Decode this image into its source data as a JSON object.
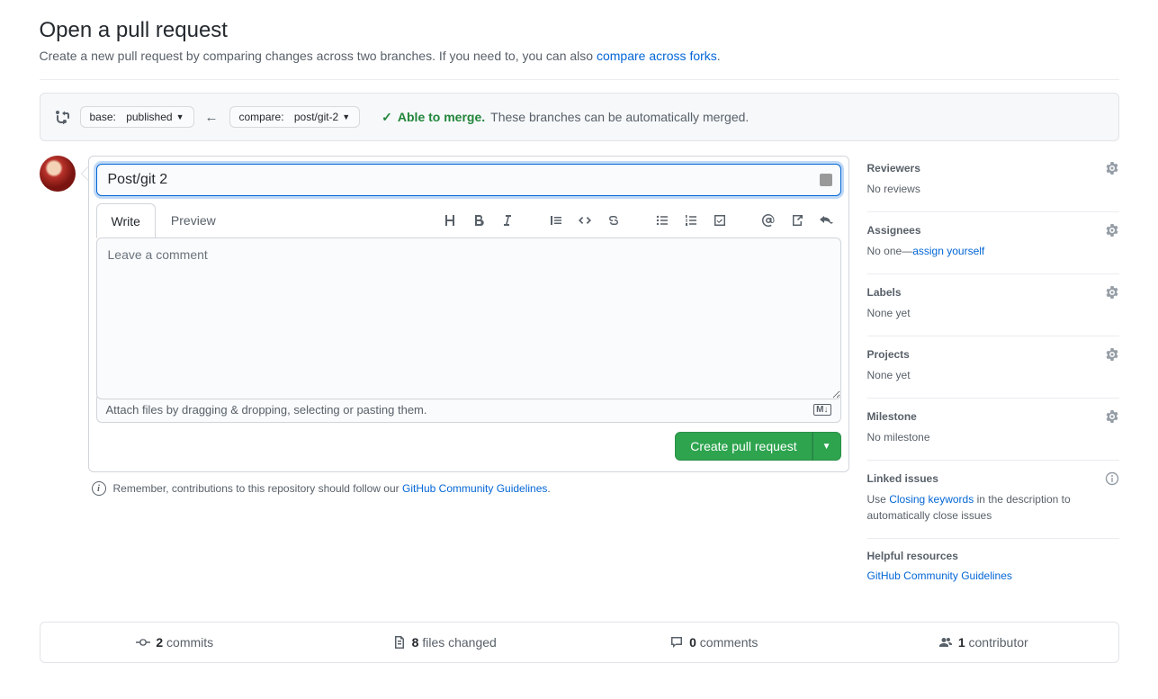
{
  "header": {
    "title": "Open a pull request",
    "desc_pre": "Create a new pull request by comparing changes across two branches. If you need to, you can also ",
    "desc_link": "compare across forks",
    "desc_post": "."
  },
  "compare": {
    "base_label": "base:",
    "base_value": "published",
    "compare_label": "compare:",
    "compare_value": "post/git-2",
    "able": "Able to merge.",
    "note": "These branches can be automatically merged."
  },
  "editor": {
    "title_value": "Post/git 2",
    "tab_write": "Write",
    "tab_preview": "Preview",
    "comment_placeholder": "Leave a comment",
    "attach_hint": "Attach files by dragging & dropping, selecting or pasting them.",
    "create_btn": "Create pull request"
  },
  "reminder": {
    "pre": "Remember, contributions to this repository should follow our ",
    "link": "GitHub Community Guidelines",
    "post": "."
  },
  "sidebar": {
    "reviewers": {
      "title": "Reviewers",
      "content": "No reviews"
    },
    "assignees": {
      "title": "Assignees",
      "pre": "No one—",
      "link": "assign yourself"
    },
    "labels": {
      "title": "Labels",
      "content": "None yet"
    },
    "projects": {
      "title": "Projects",
      "content": "None yet"
    },
    "milestone": {
      "title": "Milestone",
      "content": "No milestone"
    },
    "linked": {
      "title": "Linked issues",
      "pre": "Use ",
      "link": "Closing keywords",
      "post": " in the description to automatically close issues"
    },
    "resources": {
      "title": "Helpful resources",
      "link": "GitHub Community Guidelines"
    }
  },
  "stats": {
    "commits_n": "2",
    "commits_l": "commits",
    "files_n": "8",
    "files_l": "files changed",
    "comments_n": "0",
    "comments_l": "comments",
    "contrib_n": "1",
    "contrib_l": "contributor"
  }
}
